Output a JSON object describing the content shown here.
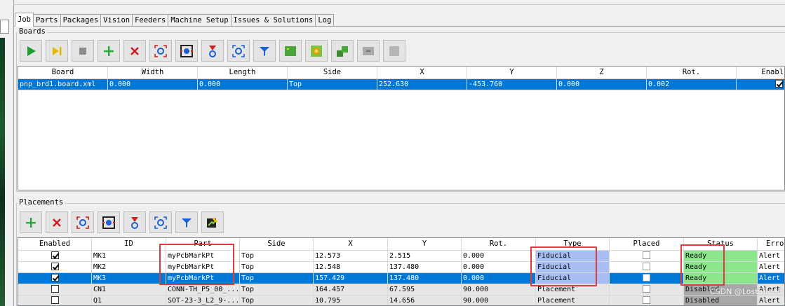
{
  "tabs": [
    "Job",
    "Parts",
    "Packages",
    "Vision",
    "Feeders",
    "Machine Setup",
    "Issues & Solutions",
    "Log"
  ],
  "boards": {
    "title": "Boards",
    "toolbar": [
      "play-icon",
      "step-icon",
      "stop-icon",
      "add-icon",
      "remove-icon",
      "capture-icon",
      "position-camera-icon",
      "position-nozzle-icon",
      "fiducial-check-icon",
      "filter-icon",
      "board-icon",
      "panel-icon",
      "copy-board-icon",
      "move-board-icon",
      "disabled-icon"
    ],
    "columns": [
      "Board",
      "Width",
      "Length",
      "Side",
      "X",
      "Y",
      "Z",
      "Rot.",
      "Enabl"
    ],
    "rows": [
      {
        "board": "pnp_brd1.board.xml",
        "width": "0.000",
        "length": "0.000",
        "side": "Top",
        "x": "252.630",
        "y": "-453.760",
        "z": "0.000",
        "rot": "0.002",
        "enabled": true
      }
    ]
  },
  "placements": {
    "title": "Placements",
    "toolbar": [
      "add-icon",
      "remove-icon",
      "capture-icon",
      "position-camera-icon",
      "position-nozzle-icon",
      "fiducial-check-icon",
      "filter-icon",
      "edit-icon"
    ],
    "columns": [
      "Enabled",
      "ID",
      "Part",
      "Side",
      "X",
      "Y",
      "Rot.",
      "Type",
      "Placed",
      "Status",
      "Error"
    ],
    "rows": [
      {
        "enabled": true,
        "id": "MK1",
        "part": "myPcbMarkPt",
        "side": "Top",
        "x": "12.573",
        "y": "2.515",
        "rot": "0.000",
        "type": "Fiducial",
        "placed": false,
        "status": "Ready",
        "error": "Alert"
      },
      {
        "enabled": true,
        "id": "MK2",
        "part": "myPcbMarkPt",
        "side": "Top",
        "x": "12.548",
        "y": "137.480",
        "rot": "0.000",
        "type": "Fiducial",
        "placed": false,
        "status": "Ready",
        "error": "Alert"
      },
      {
        "enabled": true,
        "id": "MK3",
        "part": "myPcbMarkPt",
        "side": "Top",
        "x": "157.429",
        "y": "137.480",
        "rot": "0.000",
        "type": "Fiducial",
        "placed": false,
        "status": "Ready",
        "error": "Alert"
      },
      {
        "enabled": false,
        "id": "CN1",
        "part": "CONN-TH_P5_00_...",
        "side": "Top",
        "x": "164.457",
        "y": "67.595",
        "rot": "90.000",
        "type": "Placement",
        "placed": false,
        "status": "Disabled",
        "error": "Alert"
      },
      {
        "enabled": false,
        "id": "Q1",
        "part": "SOT-23-3_L2_9-...",
        "side": "Top",
        "x": "10.795",
        "y": "14.656",
        "rot": "90.000",
        "type": "Placement",
        "placed": false,
        "status": "Disabled",
        "error": "Alert"
      }
    ]
  },
  "watermark": "CSDN @LostSpeed",
  "colors": {
    "selection": "#0078d7",
    "fiducial": "#a9bdf5",
    "ready": "#8ce68c",
    "disabled": "#a8a8a8",
    "highlight": "#e0393e"
  }
}
